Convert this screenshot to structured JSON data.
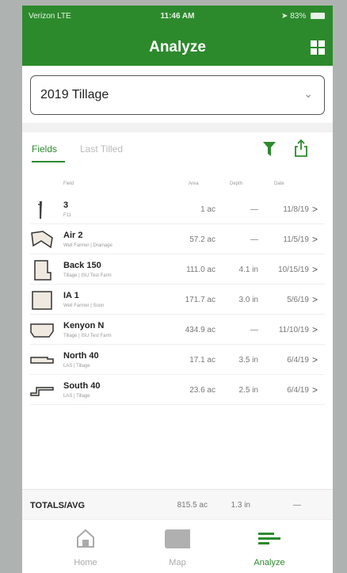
{
  "status": {
    "carrier": "Verizon LTE",
    "time": "11:46 AM",
    "battery": "83%"
  },
  "header": {
    "title": "Analyze"
  },
  "select": {
    "value": "2019 Tillage"
  },
  "tabs": [
    {
      "label": "Fields"
    },
    {
      "label": "Last Tilled"
    }
  ],
  "table": {
    "headers": [
      "Field",
      "Area",
      "Depth",
      "Date"
    ],
    "rows": [
      {
        "name": "3",
        "sub": "F11",
        "area": "1 ac",
        "depth": "—",
        "date": "11/8/19"
      },
      {
        "name": "Air 2",
        "sub": "Well Farmer | Drainage",
        "area": "57.2 ac",
        "depth": "—",
        "date": "11/5/19"
      },
      {
        "name": "Back 150",
        "sub": "Tillage | ISU Test Farm",
        "area": "111.0 ac",
        "depth": "4.1 in",
        "date": "10/15/19"
      },
      {
        "name": "IA 1",
        "sub": "Well Farmer | Soon",
        "area": "171.7 ac",
        "depth": "3.0 in",
        "date": "5/6/19"
      },
      {
        "name": "Kenyon N",
        "sub": "Tillage | ISU Test Farm",
        "area": "434.9 ac",
        "depth": "—",
        "date": "11/10/19"
      },
      {
        "name": "North 40",
        "sub": "LAS | Tillage",
        "area": "17.1 ac",
        "depth": "3.5 in",
        "date": "6/4/19"
      },
      {
        "name": "South 40",
        "sub": "LAS | Tillage",
        "area": "23.6 ac",
        "depth": "2.5 in",
        "date": "6/4/19"
      }
    ]
  },
  "totals": {
    "label": "TOTALS/AVG",
    "area": "815.5 ac",
    "depth": "1.3 in",
    "date": "—"
  },
  "nav": [
    {
      "label": "Home"
    },
    {
      "label": "Map"
    },
    {
      "label": "Analyze"
    }
  ],
  "colors": {
    "accent": "#2c8a2c",
    "nav_inactive": "#aaaaaa"
  }
}
